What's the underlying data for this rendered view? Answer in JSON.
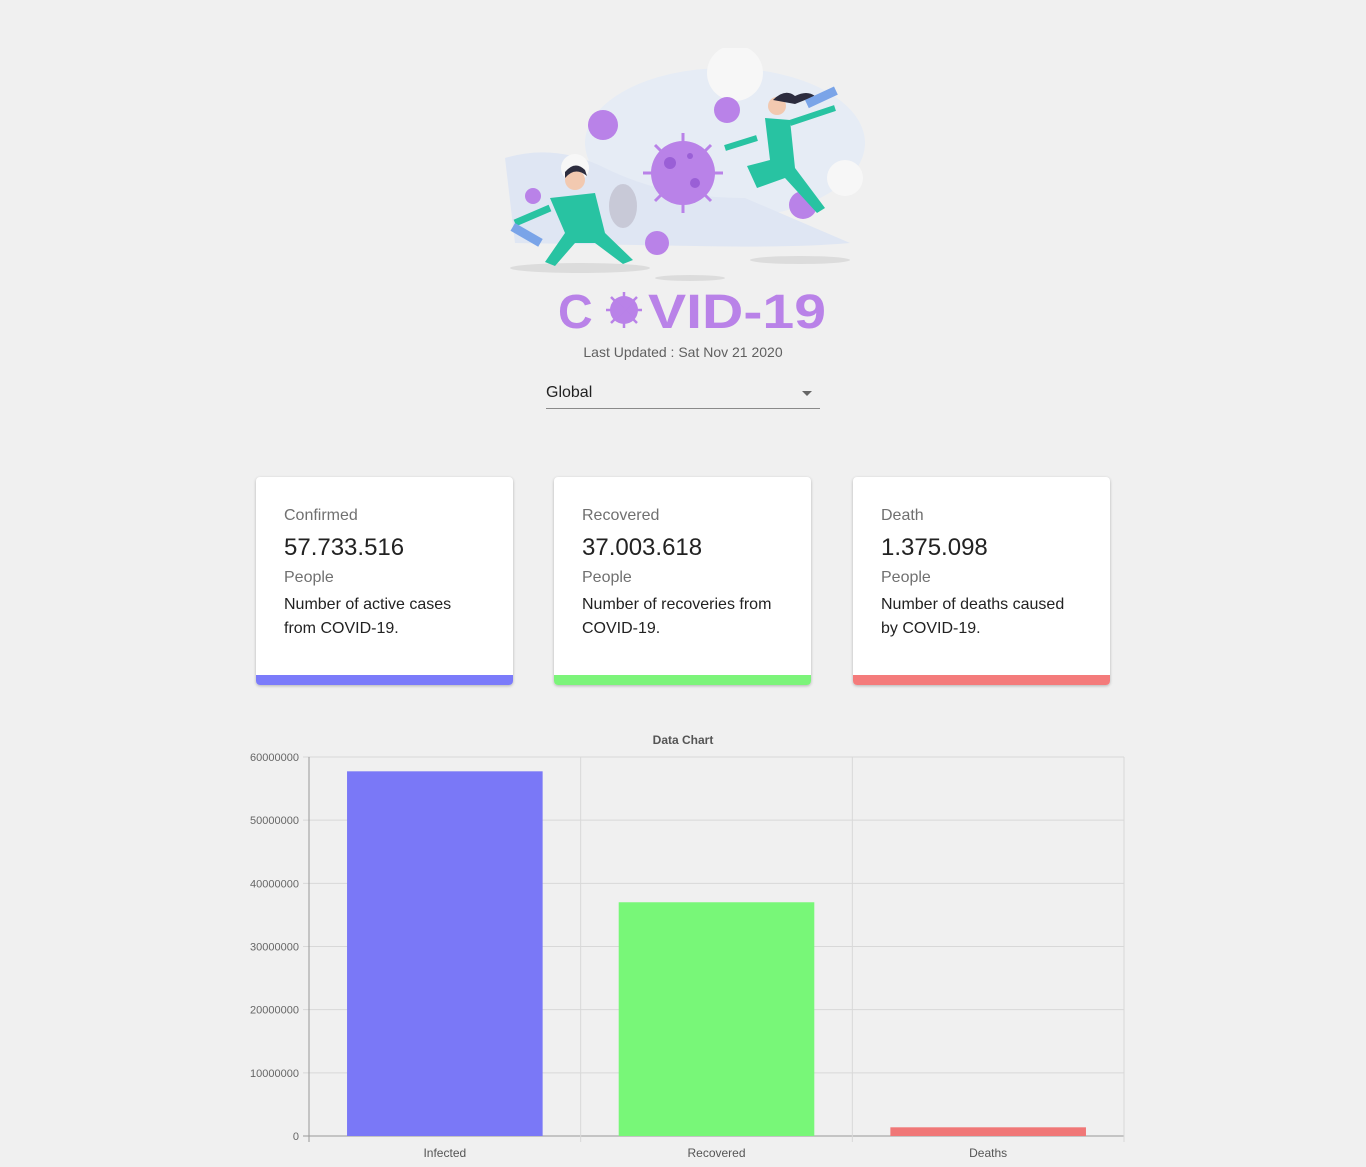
{
  "header": {
    "logo_text": "COVID-19",
    "last_updated": "Last Updated : Sat Nov 21 2020"
  },
  "country_select": {
    "selected": "Global"
  },
  "cards": [
    {
      "title": "Confirmed",
      "value": "57.733.516",
      "unit": "People",
      "description": "Number of active cases from COVID-19.",
      "accent": "#7b7bfa"
    },
    {
      "title": "Recovered",
      "value": "37.003.618",
      "unit": "People",
      "description": "Number of recoveries from COVID-19.",
      "accent": "#7cf47a"
    },
    {
      "title": "Death",
      "value": "1.375.098",
      "unit": "People",
      "description": "Number of deaths caused by COVID-19.",
      "accent": "#f47b7b"
    }
  ],
  "chart_data": {
    "type": "bar",
    "title": "Data Chart",
    "categories": [
      "Infected",
      "Recovered",
      "Deaths"
    ],
    "values": [
      57733516,
      37003618,
      1375098
    ],
    "colors": [
      "#7a78f7",
      "#78f778",
      "#f07777"
    ],
    "ylim": [
      0,
      60000000
    ],
    "yticks": [
      "0",
      "10000000",
      "20000000",
      "30000000",
      "40000000",
      "50000000",
      "60000000"
    ],
    "xlabel": "",
    "ylabel": "",
    "grid": true
  }
}
